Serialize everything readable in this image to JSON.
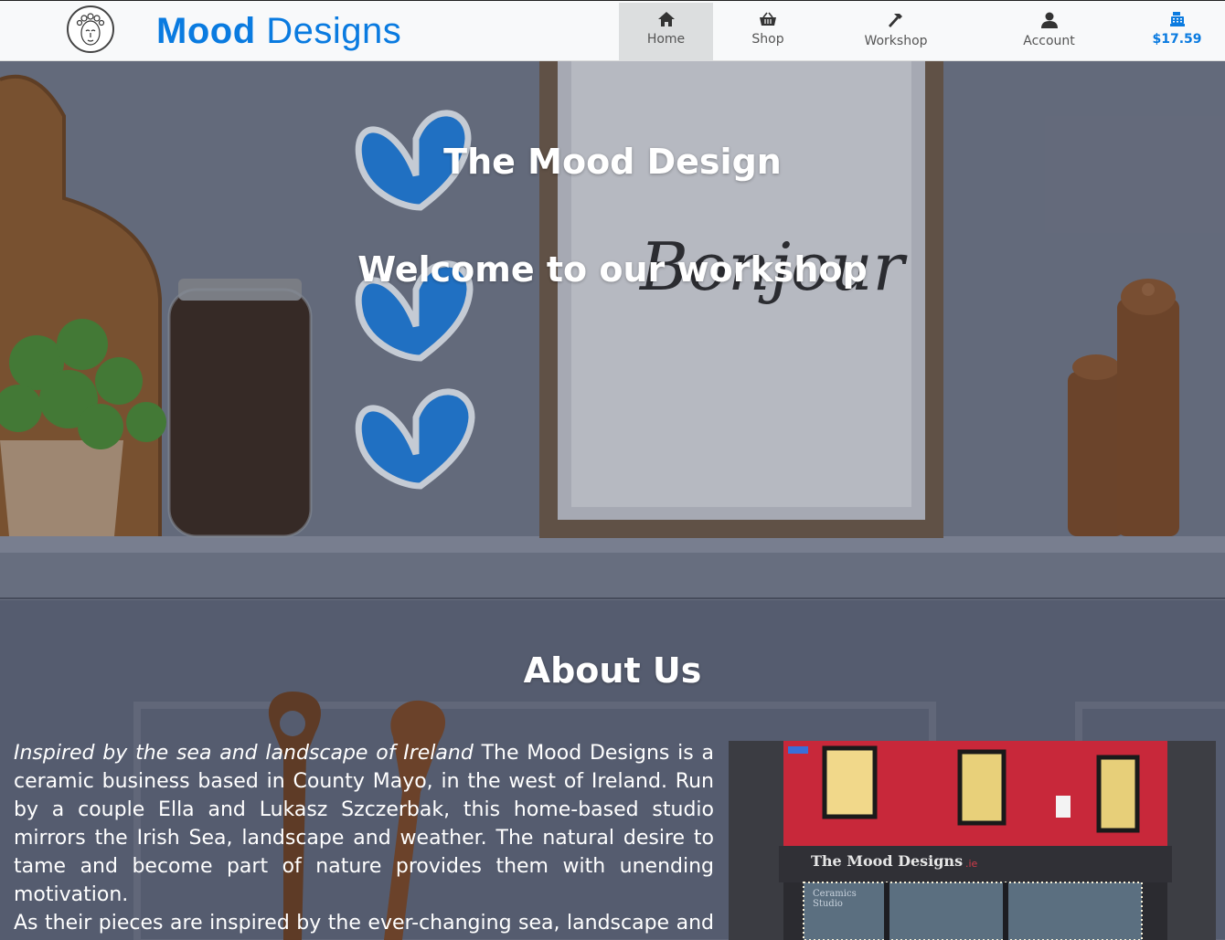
{
  "brand": {
    "name_part1": "Mood",
    "name_part2": "Designs"
  },
  "nav": {
    "home": "Home",
    "shop": "Shop",
    "workshop": "Workshop",
    "account": "Account",
    "cart_total": "$17.59"
  },
  "hero": {
    "title": "The Mood Design",
    "subtitle": "Welcome to our workshop",
    "frame_text": "Bonjour"
  },
  "about": {
    "heading": "About Us",
    "intro_italic": "Inspired by the sea and landscape of Ireland",
    "p1_rest": " The Mood Designs is a ceramic business based in County Mayo, in the west of Ireland. Run by a couple Ella and Lukasz Szczerbak, this home-based studio mirrors the Irish Sea, landscape and weather. The natural desire to tame and become part of nature provides them with unending motivation.",
    "p2": "As their pieces are inspired by the ever-changing sea, landscape and weather, a clay medium allows them to immortalize a moment in"
  },
  "store_photo": {
    "sign_text": "The Mood Designs",
    "sign_suffix": ".ie",
    "window_text_1": "Ceramics",
    "window_text_2": "Studio"
  },
  "colors": {
    "brand_blue": "#0a7be0",
    "nav_bg": "#f8f9fa",
    "nav_active_bg": "#dcdedf",
    "store_red": "#c8283a",
    "heart_blue": "#1f7fe0"
  }
}
